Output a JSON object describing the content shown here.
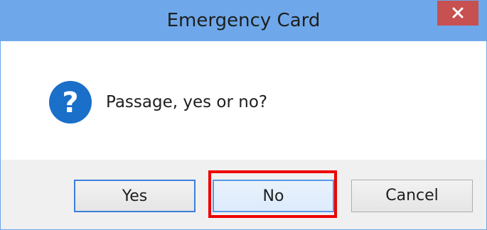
{
  "window": {
    "title": "Emergency Card",
    "close_icon": "close-icon"
  },
  "message": {
    "icon": "question-icon",
    "text": "Passage, yes or no?"
  },
  "buttons": {
    "yes": "Yes",
    "no": "No",
    "cancel": "Cancel"
  },
  "colors": {
    "titlebar": "#6ea8ea",
    "close_button": "#c75050",
    "question_icon": "#1a6fc9",
    "highlight": "#ee0000"
  }
}
